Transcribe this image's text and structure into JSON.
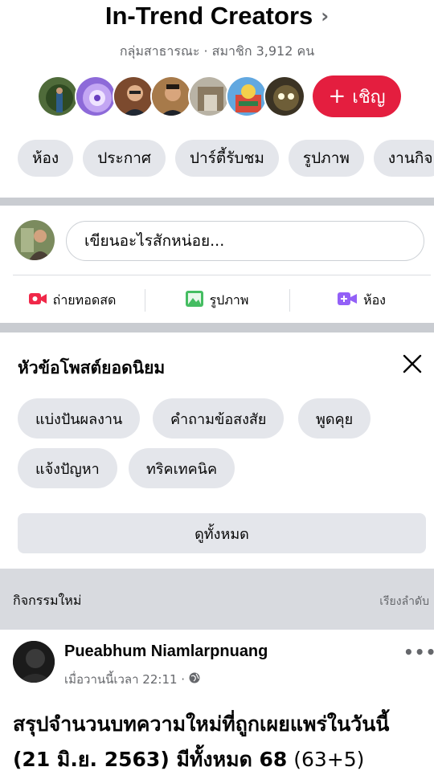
{
  "group": {
    "title": "In-Trend Creators",
    "subtitle": "กลุ่มสาธารณะ · สมาชิก 3,912 คน",
    "invite_label": "เชิญ"
  },
  "tabs": [
    "ห้อง",
    "ประกาศ",
    "ปาร์ตี้รับชม",
    "รูปภาพ",
    "งานกิจ"
  ],
  "composer": {
    "placeholder": "เขียนอะไรสักหน่อย...",
    "actions": [
      {
        "label": "ถ่ายทอดสด",
        "icon": "live-video-icon",
        "color": "#f02849"
      },
      {
        "label": "รูปภาพ",
        "icon": "photo-icon",
        "color": "#45bd62"
      },
      {
        "label": "ห้อง",
        "icon": "room-video-icon",
        "color": "#9360f7"
      }
    ]
  },
  "popular_topics": {
    "title": "หัวข้อโพสต์ยอดนิยม",
    "topics": [
      "แบ่งปันผลงาน",
      "คำถามข้อสงสัย",
      "พูดคุย",
      "แจ้งปัญหา",
      "ทริคเทคนิค"
    ],
    "see_all": "ดูทั้งหมด"
  },
  "activity": {
    "label": "กิจกรรมใหม่",
    "sort_label": "เรียงลำดับ"
  },
  "post": {
    "author": "Pueabhum Niamlarpnuang",
    "time": "เมื่อวานนี้เวลา 22:11 ·",
    "text_line1": "สรุปจำนวนบทความใหม่ที่ถูกเผยแพร่ในวันนี้",
    "text_line2_bold": "(21 มิ.ย. 2563) มีทั้งหมด 68",
    "text_line2_rest": " (63+5)"
  },
  "colors": {
    "invite": "#e41e3f",
    "pill": "#e4e6eb",
    "divider": "#c9ccd1",
    "muted": "#65676b"
  }
}
